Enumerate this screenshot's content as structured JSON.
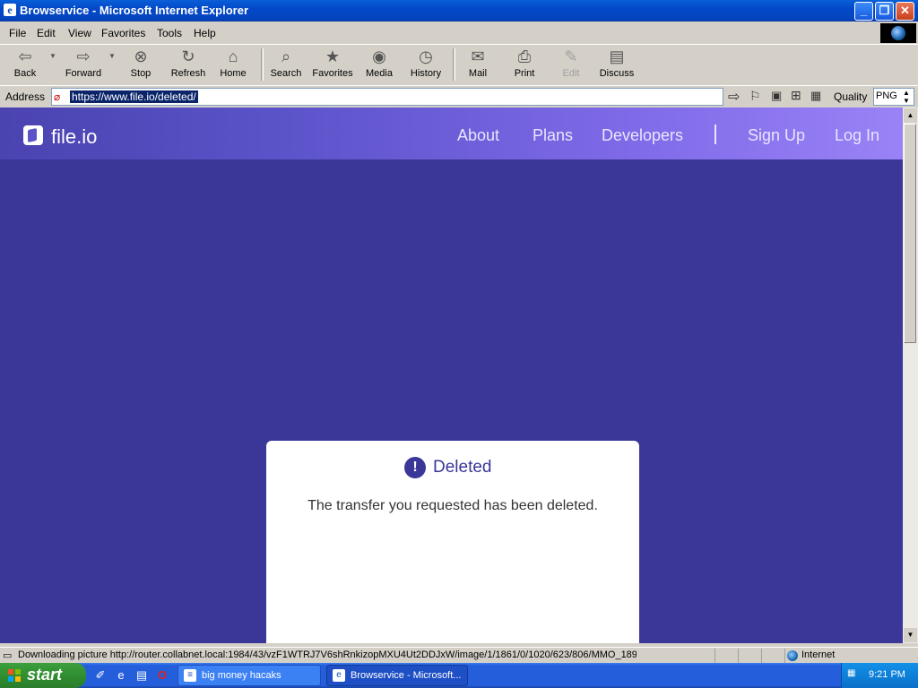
{
  "window": {
    "title": "Browservice - Microsoft Internet Explorer",
    "minimize": "_",
    "maximize": "❐",
    "close": "✕"
  },
  "menu": [
    "File",
    "Edit",
    "View",
    "Favorites",
    "Tools",
    "Help"
  ],
  "toolbar": {
    "back": "Back",
    "forward": "Forward",
    "stop": "Stop",
    "refresh": "Refresh",
    "home": "Home",
    "search": "Search",
    "favorites": "Favorites",
    "media": "Media",
    "history": "History",
    "mail": "Mail",
    "print": "Print",
    "edit": "Edit",
    "discuss": "Discuss"
  },
  "address": {
    "label": "Address",
    "url": "https://www.file.io/deleted/",
    "quality_label": "Quality",
    "quality_value": "PNG"
  },
  "site": {
    "logo": "file.io",
    "nav": [
      "About",
      "Plans",
      "Developers",
      "Sign Up",
      "Log In"
    ],
    "card": {
      "icon": "!",
      "title": "Deleted",
      "message": "The transfer you requested has been deleted."
    }
  },
  "status": {
    "text": "Downloading picture http://router.collabnet.local:1984/43/vzF1WTRJ7V6shRnkizopMXU4Ut2DDJxW/image/1/1861/0/1020/623/806/MMO_189_",
    "zone": "Internet"
  },
  "taskbar": {
    "start": "start",
    "tasks": [
      "big money hacaks",
      "Browservice - Microsoft..."
    ],
    "clock": "9:21 PM"
  },
  "colors": {
    "page_bg": "#3a3798",
    "header_start": "#4a43b0",
    "header_end": "#9a82f6",
    "xp_blue": "#245edb"
  }
}
